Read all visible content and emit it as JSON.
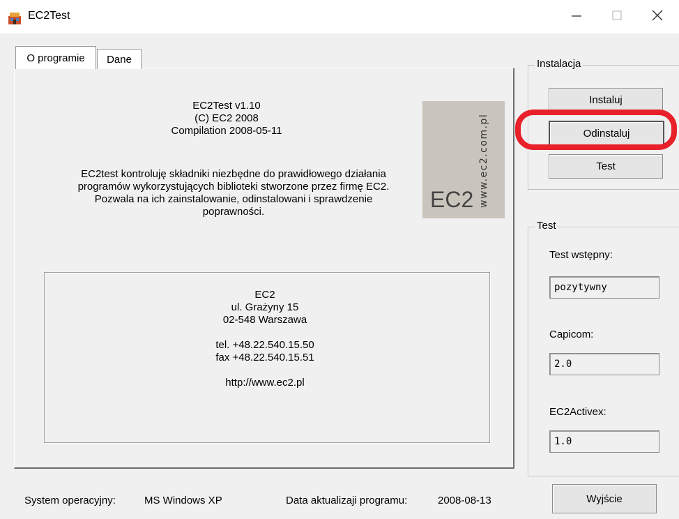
{
  "window": {
    "title": "EC2Test",
    "icons": {
      "app": "app-icon",
      "minimize": "minimize-icon",
      "maximize": "maximize-icon",
      "close": "close-icon"
    }
  },
  "tabs": [
    {
      "label": "O programie",
      "active": true
    },
    {
      "label": "Dane",
      "active": false
    }
  ],
  "about": {
    "version": "EC2Test v1.10",
    "copyright": "(C) EC2 2008",
    "compilation": "Compilation 2008-05-11",
    "description_lines": [
      "EC2test kontroluję składniki niezbędne do prawidłowego działania",
      "programów wykorzystujących biblioteki stworzone przez firmę EC2.",
      "Pozwala na ich zainstalowanie, odinstalowani i sprawdzenie",
      "poprawności."
    ],
    "logo": {
      "brand": "EC2",
      "url": "www.ec2.com.pl",
      "background": "#c9c5bd"
    },
    "contact": {
      "company": "EC2",
      "street": "ul. Grażyny 15",
      "city": "02-548 Warszawa",
      "phone": "tel. +48.22.540.15.50",
      "fax": "fax +48.22.540.15.51",
      "website": "http://www.ec2.pl"
    }
  },
  "installation": {
    "legend": "Instalacja",
    "install_label": "Instaluj",
    "uninstall_label": "Odinstaluj",
    "test_label": "Test"
  },
  "test": {
    "legend": "Test",
    "pretest_label": "Test wstępny:",
    "pretest_value": "pozytywny",
    "capicom_label": "Capicom:",
    "capicom_value": "2.0",
    "activex_label": "EC2Activex:",
    "activex_value": "1.0"
  },
  "exit_label": "Wyjście",
  "status": {
    "os_label": "System operacyjny:",
    "os_value": "MS Windows XP",
    "date_label": "Data aktualizaji programu:",
    "date_value": "2008-08-13"
  },
  "colors": {
    "highlight": "#e8202a",
    "window_bg": "#f0f0f0"
  }
}
